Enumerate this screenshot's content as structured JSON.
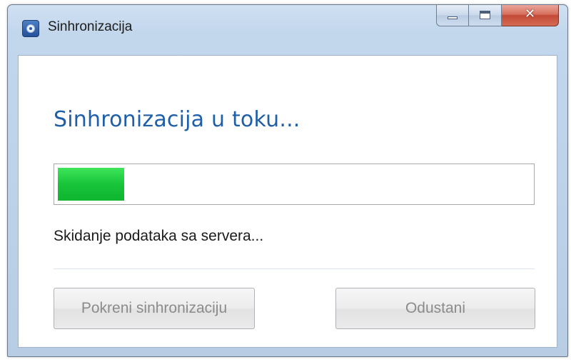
{
  "window": {
    "title": "Sinhronizacija",
    "icon": "sync-app-icon",
    "close_glyph": "✕"
  },
  "main": {
    "heading": "Sinhronizacija u toku...",
    "progress_fraction": 0.14,
    "status": "Skidanje podataka sa servera..."
  },
  "buttons": {
    "start_label": "Pokreni sinhronizaciju",
    "start_enabled": false,
    "cancel_label": "Odustani",
    "cancel_enabled": false
  },
  "colors": {
    "heading": "#1f5fa8",
    "progress_fill": "#18c43a",
    "disabled_text": "#8b8b8b"
  }
}
